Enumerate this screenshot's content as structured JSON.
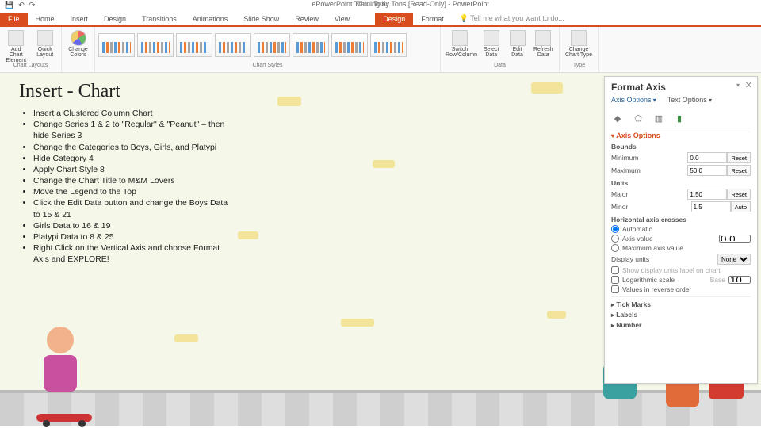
{
  "title_bar": {
    "qat": [
      "💾",
      "↶",
      "↷"
    ],
    "doc_title": "ePowerPoint Training by Tons [Read-Only] - PowerPoint",
    "chart_tools": "Chart Tools"
  },
  "tabs": {
    "file": "File",
    "items": [
      "Home",
      "Insert",
      "Design",
      "Transitions",
      "Animations",
      "Slide Show",
      "Review",
      "View"
    ],
    "chart_tabs": [
      "Design",
      "Format"
    ],
    "active_chart_tab": "Design",
    "tell_me": "Tell me what you want to do..."
  },
  "ribbon": {
    "layouts": {
      "add": "Add Chart Element",
      "quick": "Quick Layout",
      "label": "Chart Layouts"
    },
    "colors": {
      "btn": "Change Colors"
    },
    "styles": {
      "label": "Chart Styles"
    },
    "data": {
      "switch": "Switch Row/Column",
      "select": "Select Data",
      "edit": "Edit Data",
      "refresh": "Refresh Data",
      "label": "Data"
    },
    "type": {
      "change": "Change Chart Type",
      "label": "Type"
    }
  },
  "slide": {
    "title": "Insert - Chart",
    "bullets": [
      "Insert a Clustered Column Chart",
      "Change Series 1 & 2 to \"Regular\" & \"Peanut\" – then hide Series 3",
      "Change the Categories to Boys, Girls, and Platypi",
      "Hide Category 4",
      "Apply Chart Style 8",
      "Change the Chart Title to M&M Lovers",
      "Move the Legend to the Top",
      "Click the Edit Data button and change the Boys Data to 15 & 21",
      "Girls Data to 16 & 19",
      "Platypi Data to 8 & 25",
      "Right Click on the Vertical Axis and choose Format Axis and EXPLORE!"
    ]
  },
  "pane": {
    "title": "Format Axis",
    "opts": {
      "axis": "Axis Options",
      "text": "Text Options"
    },
    "section": "Axis Options",
    "bounds": {
      "label": "Bounds",
      "min_label": "Minimum",
      "min": "0.0",
      "min_btn": "Reset",
      "max_label": "Maximum",
      "max": "50.0",
      "max_btn": "Reset"
    },
    "units": {
      "label": "Units",
      "major_label": "Major",
      "major": "1.50",
      "major_btn": "Reset",
      "minor_label": "Minor",
      "minor": "1.5",
      "minor_btn": "Auto"
    },
    "crosses": {
      "label": "Horizontal axis crosses",
      "auto": "Automatic",
      "axisval": "Axis value",
      "axisval_val": "0.0",
      "maxval": "Maximum axis value"
    },
    "display": {
      "label": "Display units",
      "value": "None",
      "chk1": "Show display units label on chart",
      "log": "Logarithmic scale",
      "base_label": "Base",
      "base": "10",
      "rev": "Values in reverse order"
    },
    "groups": {
      "tick": "Tick Marks",
      "labels": "Labels",
      "number": "Number"
    }
  }
}
